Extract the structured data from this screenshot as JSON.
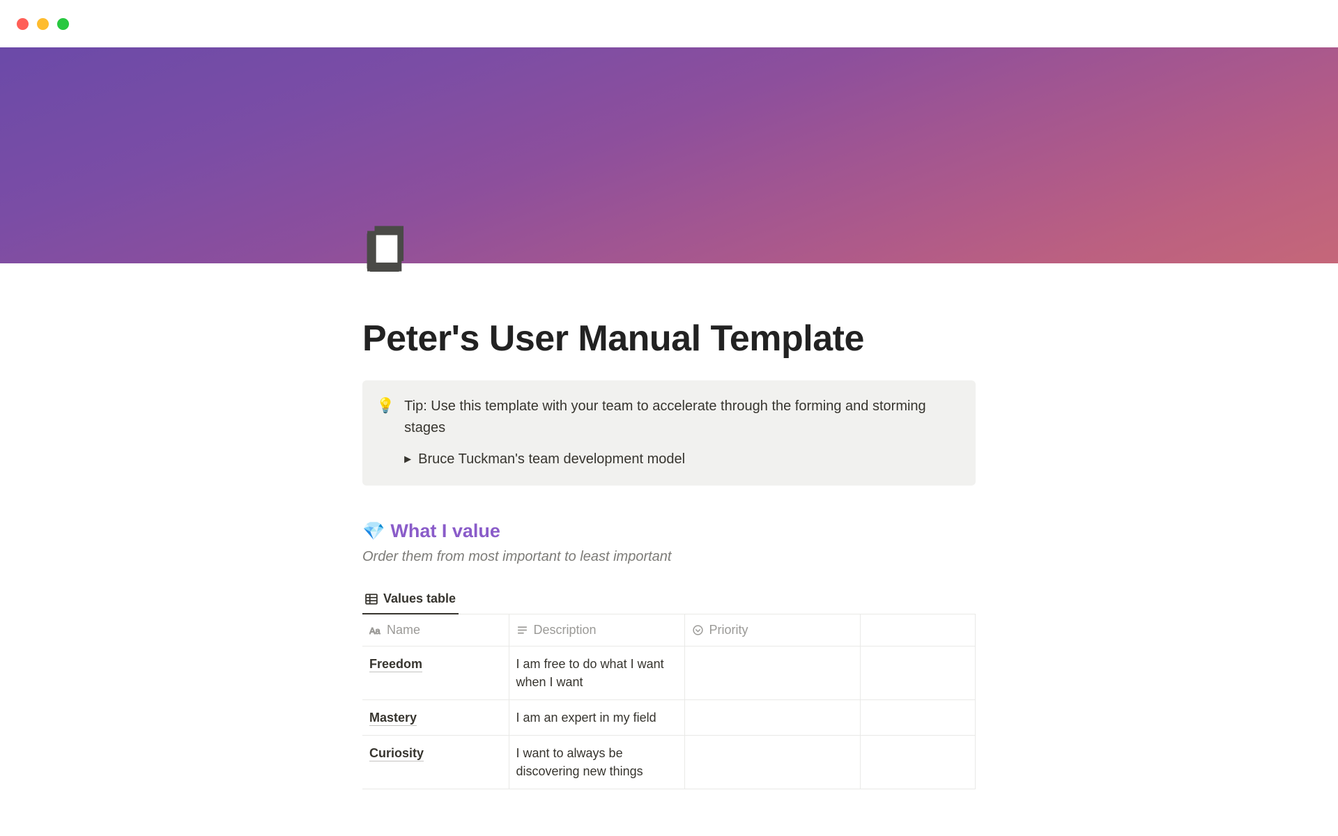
{
  "page": {
    "title": "Peter's User Manual Template",
    "icon_name": "notebook-icon"
  },
  "callout": {
    "emoji": "💡",
    "tip_text": "Tip: Use this template with your team to accelerate through the forming and storming stages",
    "toggle_label": "Bruce Tuckman's team development model"
  },
  "section": {
    "emoji": "💎",
    "heading": "What I value",
    "subtitle": "Order them from most important to least important"
  },
  "database": {
    "tab_label": "Values table",
    "columns": {
      "name": "Name",
      "description": "Description",
      "priority": "Priority"
    },
    "rows": [
      {
        "name": "Freedom",
        "description": "I am free to do what I want when I want",
        "priority": ""
      },
      {
        "name": "Mastery",
        "description": "I am an expert in my field",
        "priority": ""
      },
      {
        "name": "Curiosity",
        "description": "I want to always be discovering new things",
        "priority": ""
      }
    ]
  }
}
